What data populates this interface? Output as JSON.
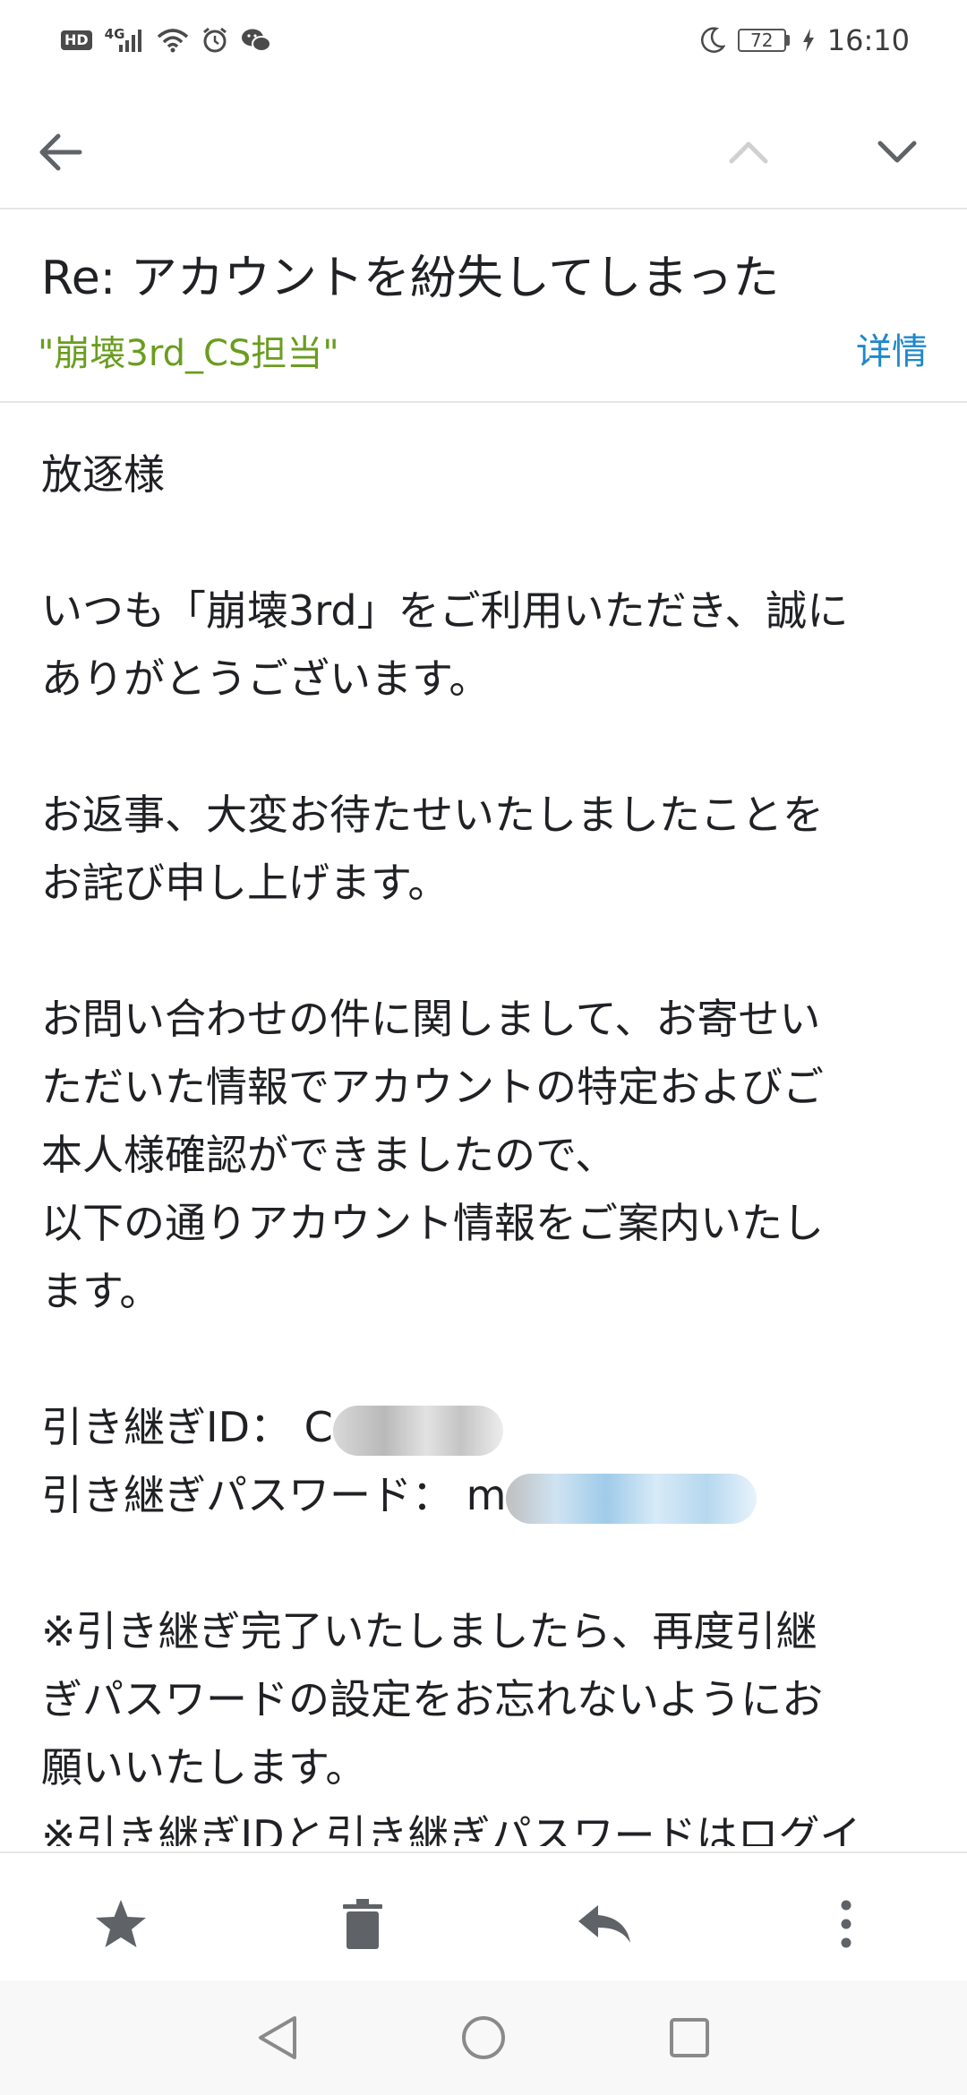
{
  "status_bar": {
    "hd": "HD",
    "network": "4G",
    "battery": "72",
    "time": "16:10",
    "icons": [
      "hd-icon",
      "signal-icon",
      "wifi-icon",
      "alarm-icon",
      "wechat-icon",
      "moon-icon",
      "battery-icon",
      "charging-icon"
    ]
  },
  "app_bar": {
    "icons": [
      "back-arrow-icon",
      "chevron-up-icon",
      "chevron-down-icon"
    ]
  },
  "email": {
    "subject": "Re: アカウントを紛失してしまった",
    "sender": "\"崩壊3rd_CS担当\"",
    "details_label": "详情",
    "body": {
      "greeting": "放逐様",
      "p1_l1": "いつも「崩壊3rd」をご利用いただき、誠に",
      "p1_l2": "ありがとうございます。",
      "p2_l1": "お返事、大変お待たせいたしましたことを",
      "p2_l2": "お詫び申し上げます。",
      "p3_l1": "お問い合わせの件に関しまして、お寄せい",
      "p3_l2": "ただいた情報でアカウントの特定およびご",
      "p3_l3": "本人様確認ができましたので、",
      "p3_l4": "以下の通りアカウント情報をご案内いたし",
      "p3_l5": "ます。",
      "id_label": "引き継ぎID：",
      "id_value_visible": "C",
      "pw_label": "引き継ぎパスワード：",
      "pw_value_visible": "m",
      "note1_l1": "※引き継ぎ完了いたしましたら、再度引継",
      "note1_l2": "ぎパスワードの設定をお忘れないようにお",
      "note1_l3": "願いいたします。",
      "note2_l1": "※引き継ぎIDと引き継ぎパスワードはログイ"
    }
  },
  "actions": {
    "icons": [
      "star-icon",
      "trash-icon",
      "reply-icon",
      "more-vert-icon"
    ]
  },
  "system_nav": {
    "icons": [
      "nav-back-icon",
      "nav-home-icon",
      "nav-recents-icon"
    ]
  },
  "colors": {
    "sender": "#6a9d1f",
    "link": "#1e88c9",
    "text": "#202124",
    "icon": "#5f6368"
  }
}
